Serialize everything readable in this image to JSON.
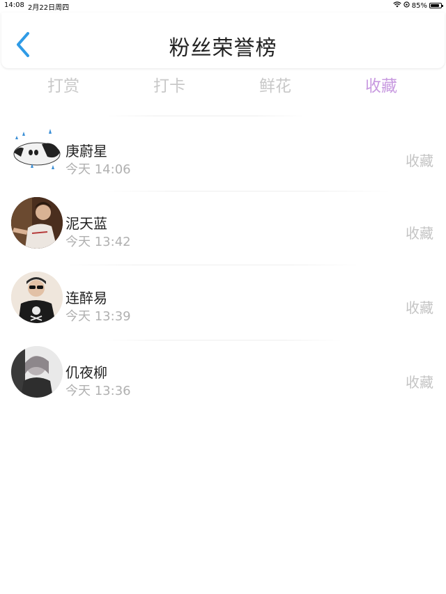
{
  "status_bar": {
    "time": "14:08",
    "date": "2月22日周四",
    "battery": "85%",
    "battery_level": 0.85
  },
  "header": {
    "title": "粉丝荣誉榜"
  },
  "tabs": [
    {
      "label": "打赏",
      "active": false
    },
    {
      "label": "打卡",
      "active": false
    },
    {
      "label": "鲜花",
      "active": false
    },
    {
      "label": "收藏",
      "active": true
    }
  ],
  "fans": [
    {
      "name": "庚蔚星",
      "time": "今天 14:06",
      "action": "收藏"
    },
    {
      "name": "泥天蓝",
      "time": "今天 13:42",
      "action": "收藏"
    },
    {
      "name": "连醉易",
      "time": "今天 13:39",
      "action": "收藏"
    },
    {
      "name": "仉夜柳",
      "time": "今天 13:36",
      "action": "收藏"
    }
  ],
  "colors": {
    "accent_tab": "#c89ae0",
    "back_icon": "#2f9be6",
    "inactive_text": "#c8c8c8"
  }
}
